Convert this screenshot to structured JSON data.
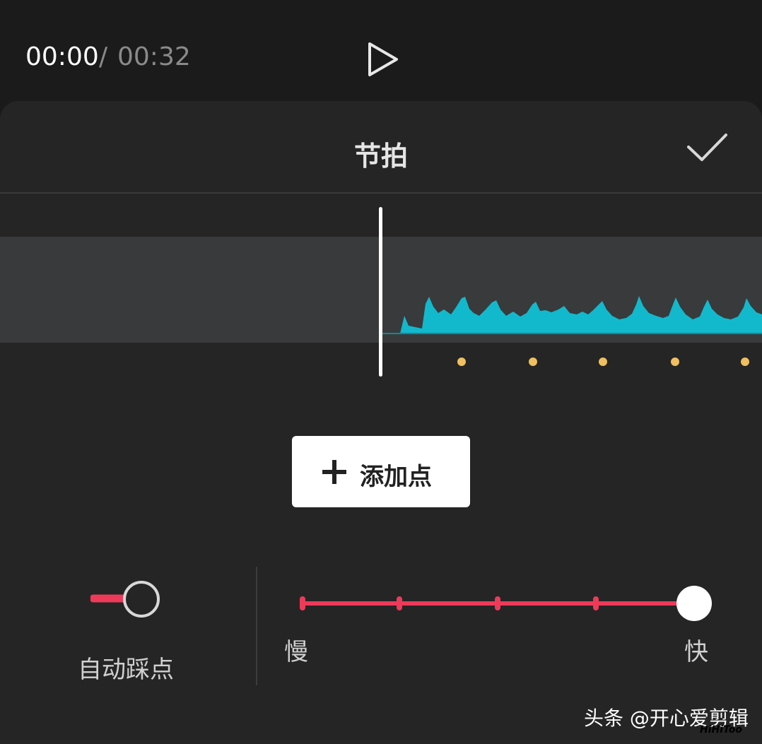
{
  "player": {
    "current_time": "00:00",
    "separator": "/",
    "total_time": "00:32",
    "play_icon": "play-icon"
  },
  "panel": {
    "title": "节拍",
    "confirm_icon": "check-icon"
  },
  "actions": {
    "add_point_icon": "plus-icon",
    "add_point_label": "添加点"
  },
  "auto_beat": {
    "label": "自动踩点",
    "enabled": false
  },
  "speed": {
    "slow_label": "慢",
    "fast_label": "快",
    "levels": 5,
    "selected_level": 5
  },
  "watermark": {
    "text": "头条 @开心爱剪辑",
    "small_text": "HiHiToo"
  },
  "colors": {
    "waveform": "#12b9cc",
    "beat_dot": "#f0c060",
    "accent": "#ee3a59"
  }
}
